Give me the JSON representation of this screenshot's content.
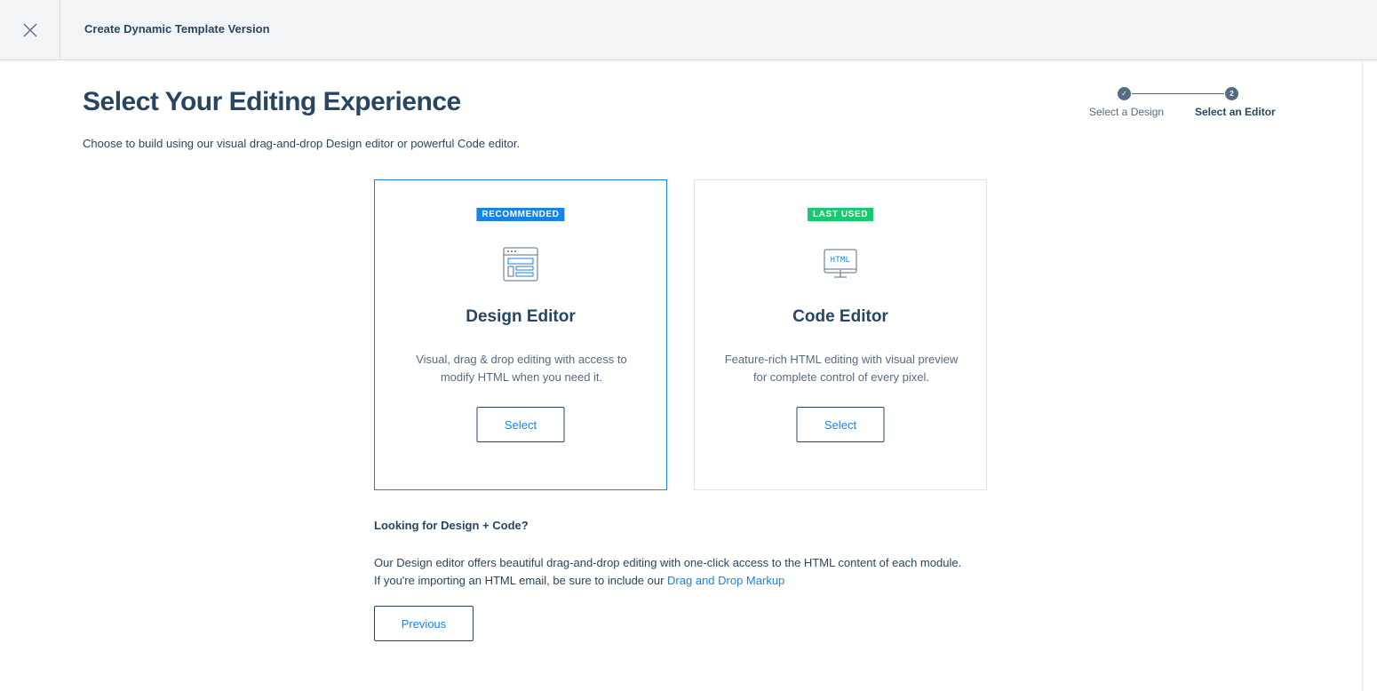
{
  "header": {
    "title": "Create Dynamic Template Version",
    "close_icon": "close-icon"
  },
  "main": {
    "title": "Select Your Editing Experience",
    "subtitle": "Choose to build using our visual drag-and-drop Design editor or powerful Code editor."
  },
  "stepper": {
    "steps": [
      {
        "label": "Select a Design",
        "marker": "✓",
        "state": "complete"
      },
      {
        "label": "Select an Editor",
        "marker": "2",
        "state": "current"
      }
    ]
  },
  "cards": [
    {
      "badge": "RECOMMENDED",
      "badge_color": "#1a82e2",
      "icon": "design-layout-icon",
      "title": "Design Editor",
      "description": "Visual, drag & drop editing with access to modify HTML when you need it.",
      "button_label": "Select",
      "selected": true
    },
    {
      "badge": "LAST USED",
      "badge_color": "#18c96e",
      "icon": "html-monitor-icon",
      "title": "Code Editor",
      "description": "Feature-rich HTML editing with visual preview for complete control of every pixel.",
      "button_label": "Select",
      "selected": false
    }
  ],
  "info": {
    "title": "Looking for Design + Code?",
    "line1": "Our Design editor offers beautiful drag-and-drop editing with one-click access to the HTML content of each module.",
    "line2_prefix": "If you're importing an HTML email, be sure to include our ",
    "link_label": "Drag and Drop Markup"
  },
  "footer": {
    "previous_label": "Previous"
  },
  "colors": {
    "accent": "#1a82e2",
    "text": "#294661",
    "success": "#18c96e"
  }
}
